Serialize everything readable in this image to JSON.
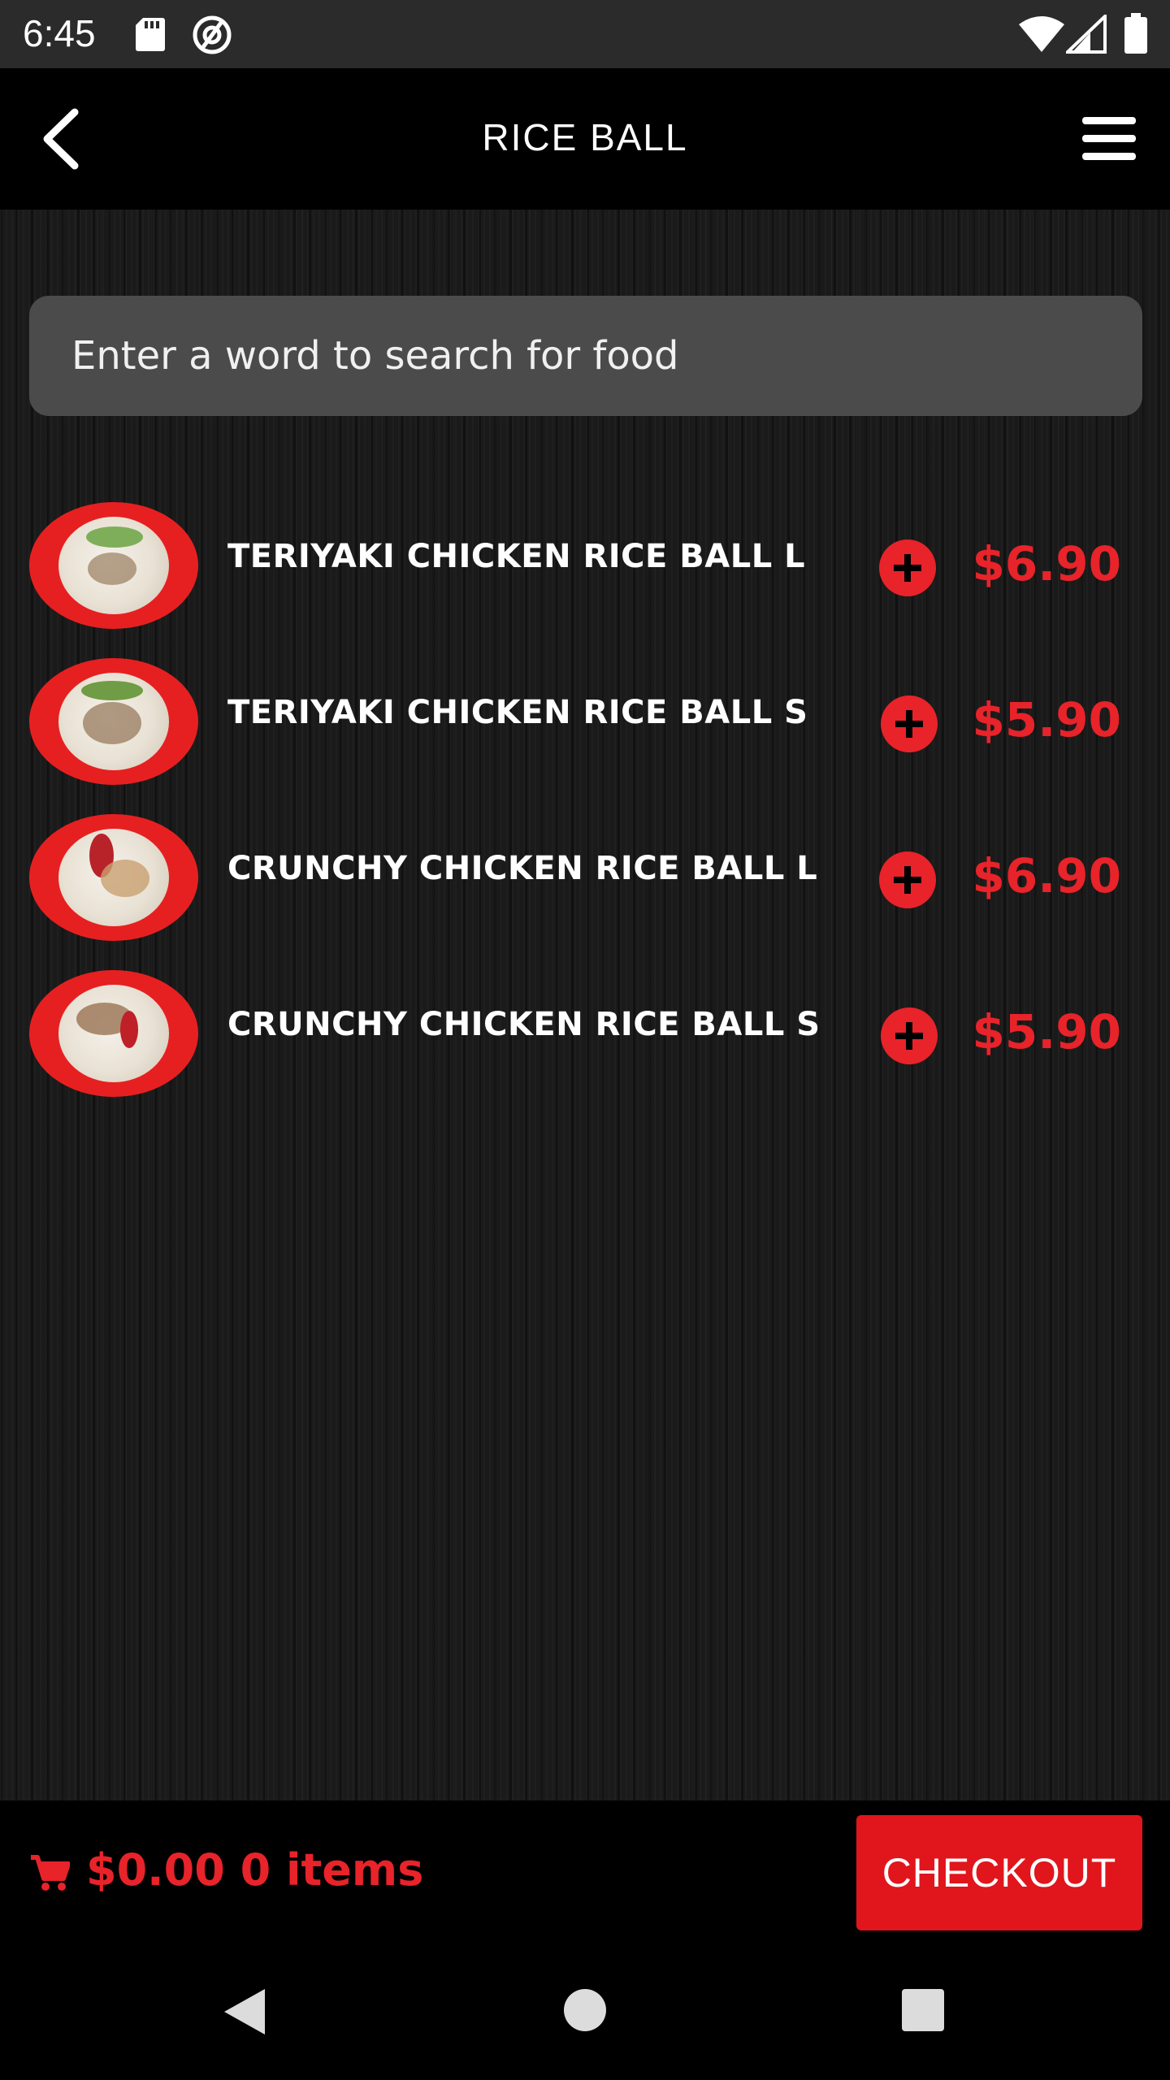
{
  "status_bar": {
    "time": "6:45",
    "icons": [
      "sd-card-icon",
      "assistant-icon",
      "wifi-icon",
      "signal-icon",
      "battery-icon"
    ]
  },
  "app_bar": {
    "title": "RICE BALL",
    "back_icon": "chevron-left-icon",
    "menu_icon": "hamburger-menu-icon"
  },
  "search": {
    "placeholder": "Enter a word to search for food",
    "value": ""
  },
  "menu_items": [
    {
      "name": "TERIYAKI CHICKEN RICE BALL L",
      "price": "$6.90",
      "image": "teriyaki-rice-ball-image"
    },
    {
      "name": "TERIYAKI CHICKEN RICE BALL S",
      "price": "$5.90",
      "image": "teriyaki-rice-ball-image"
    },
    {
      "name": "CRUNCHY CHICKEN RICE BALL L",
      "price": "$6.90",
      "image": "crunchy-rice-ball-image"
    },
    {
      "name": "CRUNCHY CHICKEN RICE BALL S",
      "price": "$5.90",
      "image": "crunchy-rice-ball-image"
    }
  ],
  "cart": {
    "summary": "$0.00 0 items",
    "icon": "cart-icon",
    "checkout_label": "CHECKOUT"
  },
  "colors": {
    "accent": "#e8232a",
    "background": "#000000",
    "status_bar": "#2b2b2b",
    "search_box": "#4b4b4b"
  }
}
